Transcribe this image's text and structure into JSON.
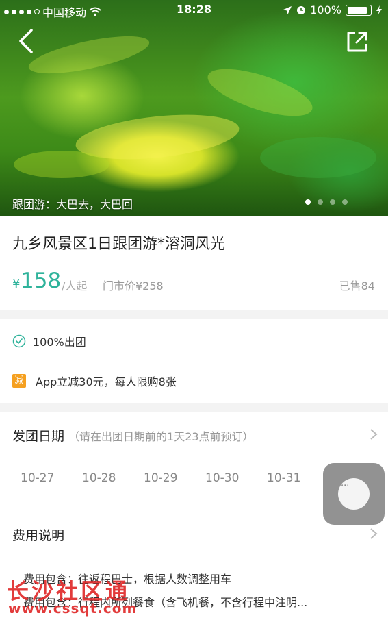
{
  "status_bar": {
    "carrier": "中国移动",
    "time": "18:28",
    "battery": "100%"
  },
  "hero": {
    "caption": "跟团游：大巴去，大巴回",
    "pages": 4,
    "active_page": 1
  },
  "product": {
    "title": "九乡风景区1日跟团游*溶洞风光",
    "currency": "¥",
    "price": "158",
    "price_unit": "/人起",
    "market_price": "门市价¥258",
    "sold": "已售84"
  },
  "guarantee": {
    "icon": "check-circle-icon",
    "text": "100%出团"
  },
  "promo": {
    "badge": "减",
    "text": "App立减30元，每人限购8张"
  },
  "departure": {
    "title": "发团日期",
    "hint": "（请在出团日期前的1天23点前预订）",
    "dates": [
      "10-27",
      "10-28",
      "10-29",
      "10-30",
      "10-31"
    ]
  },
  "fees": {
    "title": "费用说明",
    "line1": "费用包含：往返程巴士，根据人数调整用车",
    "line2": "费用包含：行程内所列餐食（含飞机餐，不含行程中注明..."
  },
  "floating_button": {
    "label": "···"
  },
  "watermark": {
    "name": "长沙社区通",
    "url": "www.cssqt.com"
  },
  "colors": {
    "accent": "#2fb39b",
    "promo": "#f5a020",
    "watermark": "#e02b2b"
  }
}
